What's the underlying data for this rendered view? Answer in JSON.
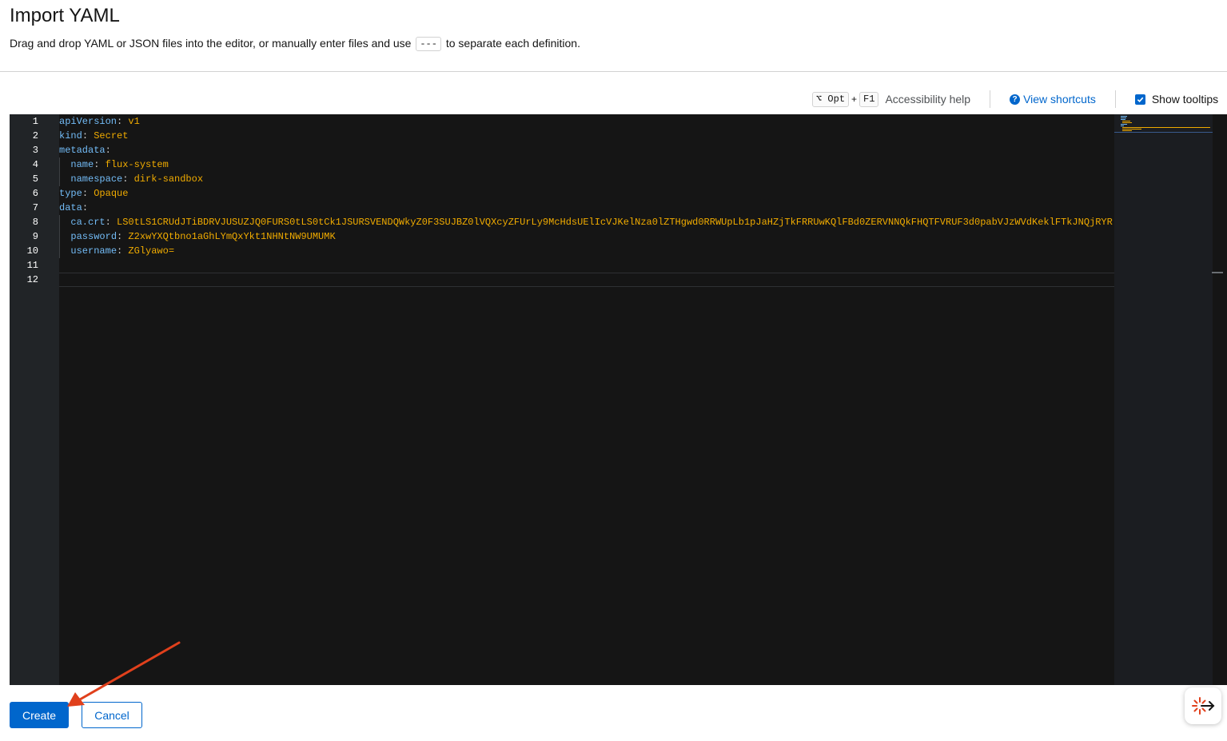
{
  "header": {
    "title": "Import YAML",
    "subtitle_before": "Drag and drop YAML or JSON files into the editor, or manually enter files and use",
    "subtitle_kbd": "---",
    "subtitle_after": "to separate each definition."
  },
  "toolbar": {
    "key_opt": "⌥ Opt",
    "key_plus": "+",
    "key_f1": "F1",
    "accessibility_help": "Accessibility help",
    "view_shortcuts": "View shortcuts",
    "show_tooltips": "Show tooltips",
    "show_tooltips_checked": true
  },
  "editor": {
    "lines": [
      {
        "n": "1",
        "indent": "",
        "key": "apiVersion",
        "val": "v1"
      },
      {
        "n": "2",
        "indent": "",
        "key": "kind",
        "val": "Secret"
      },
      {
        "n": "3",
        "indent": "",
        "key": "metadata",
        "val": ""
      },
      {
        "n": "4",
        "indent": "  ",
        "key": "name",
        "val": "flux-system"
      },
      {
        "n": "5",
        "indent": "  ",
        "key": "namespace",
        "val": "dirk-sandbox"
      },
      {
        "n": "6",
        "indent": "",
        "key": "type",
        "val": "Opaque"
      },
      {
        "n": "7",
        "indent": "",
        "key": "data",
        "val": ""
      },
      {
        "n": "8",
        "indent": "  ",
        "key": "ca.crt",
        "val": "LS0tLS1CRUdJTiBDRVJUSUZJQ0FURS0tLS0tCk1JSURSVENDQWkyZ0F3SUJBZ0lVQXcyZFUrLy9McHdsUElIcVJKelNza0lZTHgwd0RRWUpLb1pJaHZjTkFRRUwKQlFBd0ZERVNNQkFHQTFVRUF3d0pabVJzWVdKeklFTkJNQjRYR"
      },
      {
        "n": "9",
        "indent": "  ",
        "key": "password",
        "val": "Z2xwYXQtbno1aGhLYmQxYkt1NHNtNW9UMUMK"
      },
      {
        "n": "10",
        "indent": "  ",
        "key": "username",
        "val": "ZGlyawo="
      },
      {
        "n": "11",
        "indent": "",
        "key": "",
        "val": ""
      },
      {
        "n": "12",
        "indent": "",
        "key": "",
        "val": ""
      }
    ]
  },
  "actions": {
    "create": "Create",
    "cancel": "Cancel"
  },
  "colors": {
    "primary": "#0066cc",
    "editor_bg": "#151515",
    "yaml_key": "#73bcf7",
    "yaml_value": "#f0ab00",
    "annotation_arrow": "#e0401c"
  }
}
